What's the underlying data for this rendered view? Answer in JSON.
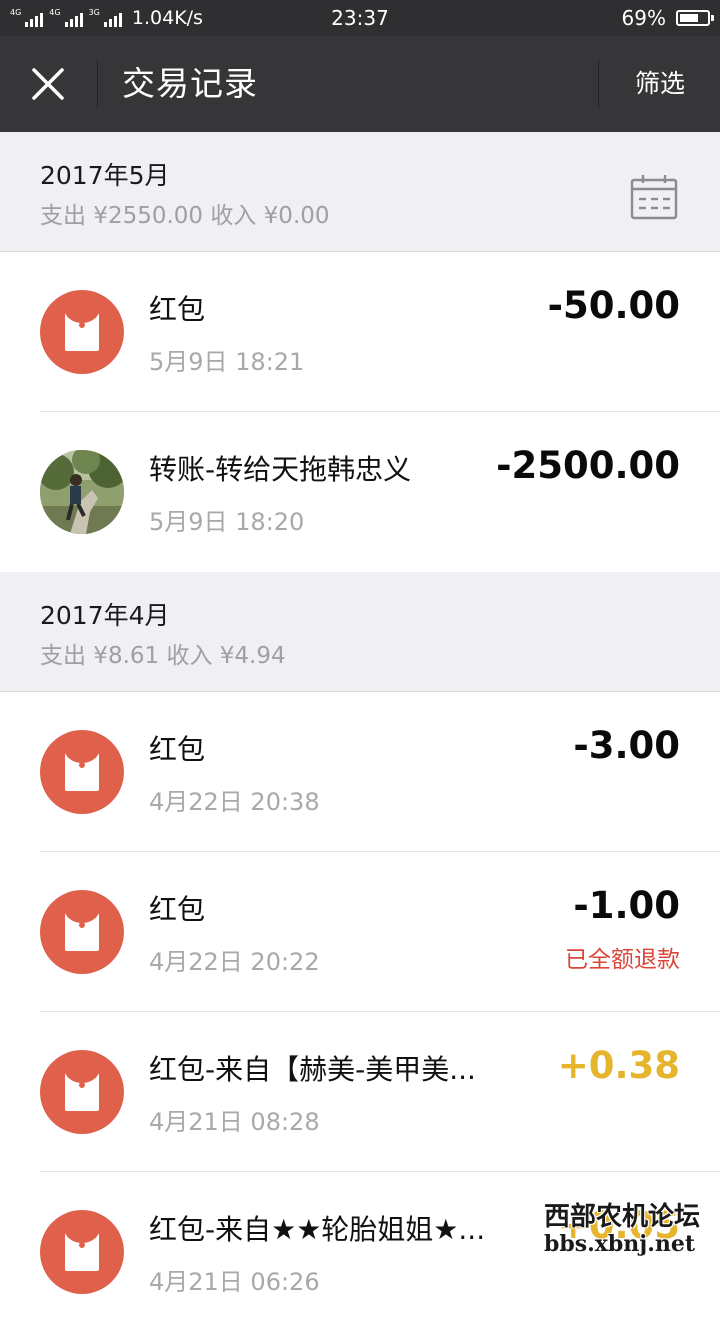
{
  "status_bar": {
    "network1": "4G",
    "network2": "4G",
    "network3": "3G",
    "speed": "1.04K/s",
    "time": "23:37",
    "battery_text": "69%",
    "battery_level": 0.69
  },
  "header": {
    "title": "交易记录",
    "filter_label": "筛选"
  },
  "months": [
    {
      "title": "2017年5月",
      "summary": "支出 ¥2550.00 收入 ¥0.00",
      "transactions": [
        {
          "icon": "red-envelope-icon",
          "title": "红包",
          "time": "5月9日 18:21",
          "amount": "-50.00",
          "type": "expense",
          "status": ""
        },
        {
          "icon": "contact-avatar",
          "title": "转账-转给天拖韩忠义",
          "time": "5月9日 18:20",
          "amount": "-2500.00",
          "type": "expense",
          "status": ""
        }
      ]
    },
    {
      "title": "2017年4月",
      "summary": "支出 ¥8.61 收入 ¥4.94",
      "transactions": [
        {
          "icon": "red-envelope-icon",
          "title": "红包",
          "time": "4月22日 20:38",
          "amount": "-3.00",
          "type": "expense",
          "status": ""
        },
        {
          "icon": "red-envelope-icon",
          "title": "红包",
          "time": "4月22日 20:22",
          "amount": "-1.00",
          "type": "expense",
          "status": "已全额退款"
        },
        {
          "icon": "red-envelope-icon",
          "title": "红包-来自【赫美-美甲美...",
          "time": "4月21日 08:28",
          "amount": "+0.38",
          "type": "income",
          "status": ""
        },
        {
          "icon": "red-envelope-icon",
          "title": "红包-来自★★轮胎姐姐★...",
          "time": "4月21日 06:26",
          "amount": "+0.05",
          "type": "income",
          "status": ""
        }
      ]
    }
  ],
  "watermark": {
    "line1": "西部农机论坛",
    "line2": "bbs.xbnj.net"
  },
  "colors": {
    "status_bar_bg": "#2f2f31",
    "title_bar_bg": "#363638",
    "section_bg": "#efeff4",
    "red_envelope": "#e0614b",
    "income": "#e6b52d",
    "refund": "#d9473a"
  }
}
